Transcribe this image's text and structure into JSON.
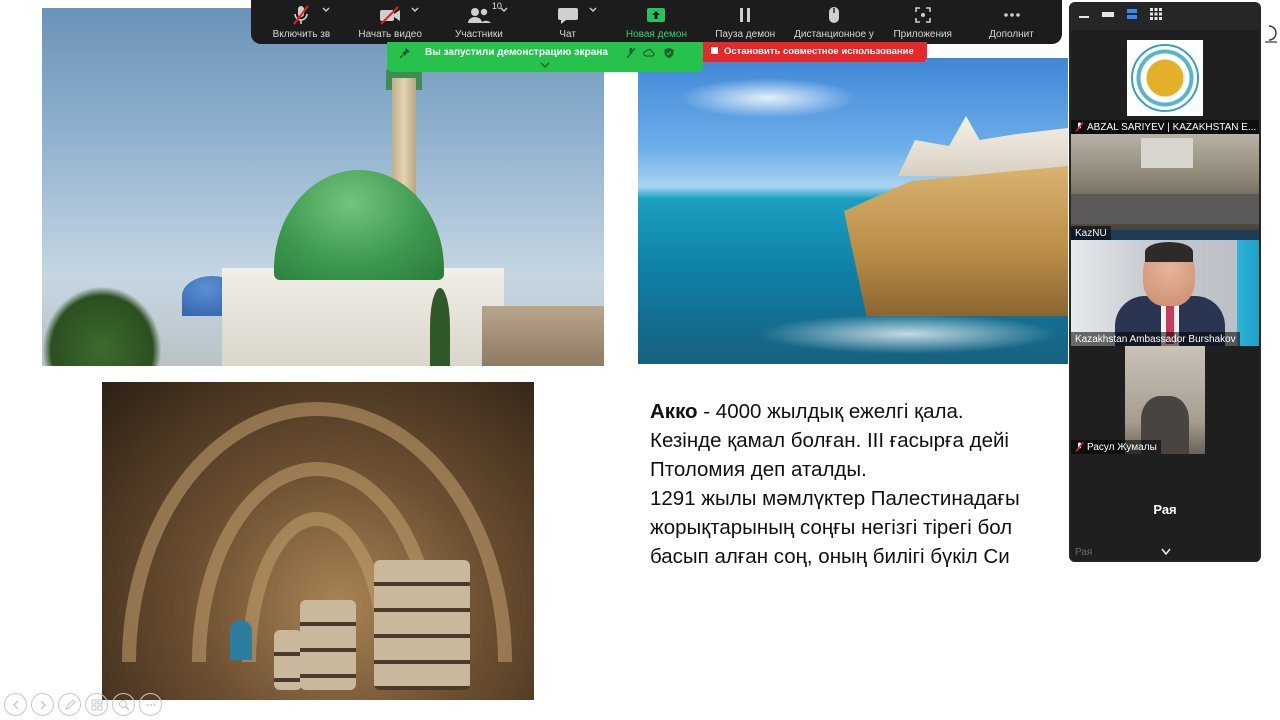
{
  "toolbar": {
    "items": [
      {
        "label": "Включить зв",
        "icon": "mic-muted-icon"
      },
      {
        "label": "Начать видео",
        "icon": "video-off-icon"
      },
      {
        "label": "Участники",
        "icon": "participants-icon",
        "count": "10"
      },
      {
        "label": "Чат",
        "icon": "chat-icon"
      },
      {
        "label": "Новая демон",
        "icon": "share-screen-icon"
      },
      {
        "label": "Пауза демон",
        "icon": "pause-icon"
      },
      {
        "label": "Дистанционное у",
        "icon": "remote-control-icon"
      },
      {
        "label": "Приложения",
        "icon": "apps-icon"
      },
      {
        "label": "Дополнит",
        "icon": "more-icon"
      }
    ]
  },
  "share_banner": {
    "text": "Вы запустили демонстрацию экрана",
    "stop_text": "Остановить совместное использование"
  },
  "slide": {
    "bold_word": "Акко",
    "lines": [
      " - 4000 жылдық ежелгі қала.",
      "Кезінде қамал болған. ІІІ ғасырға дейі",
      "Птоломия деп аталды.",
      "1291 жылы мәмлүктер Палестинадағы",
      "жорықтарының соңғы негізгі тірегі бол",
      "басып алған соң, оның билігі бүкіл Си"
    ]
  },
  "participants": [
    {
      "name": "ABZAL SARIYEV | KAZAKHSTAN E...",
      "muted": true
    },
    {
      "name": "KazNU",
      "muted": false
    },
    {
      "name": "Kazakhstan Ambassador Burshakov",
      "muted": false
    },
    {
      "name": "Расул Жумалы",
      "muted": true
    },
    {
      "name": "Рая",
      "muted": false,
      "ghost": "Рая"
    }
  ],
  "colors": {
    "toolbar_bg": "#1c1c1c",
    "share_green": "#27c24c",
    "stop_red": "#e32929",
    "panel_bg": "#262626",
    "active_label": "#2dd36f"
  }
}
